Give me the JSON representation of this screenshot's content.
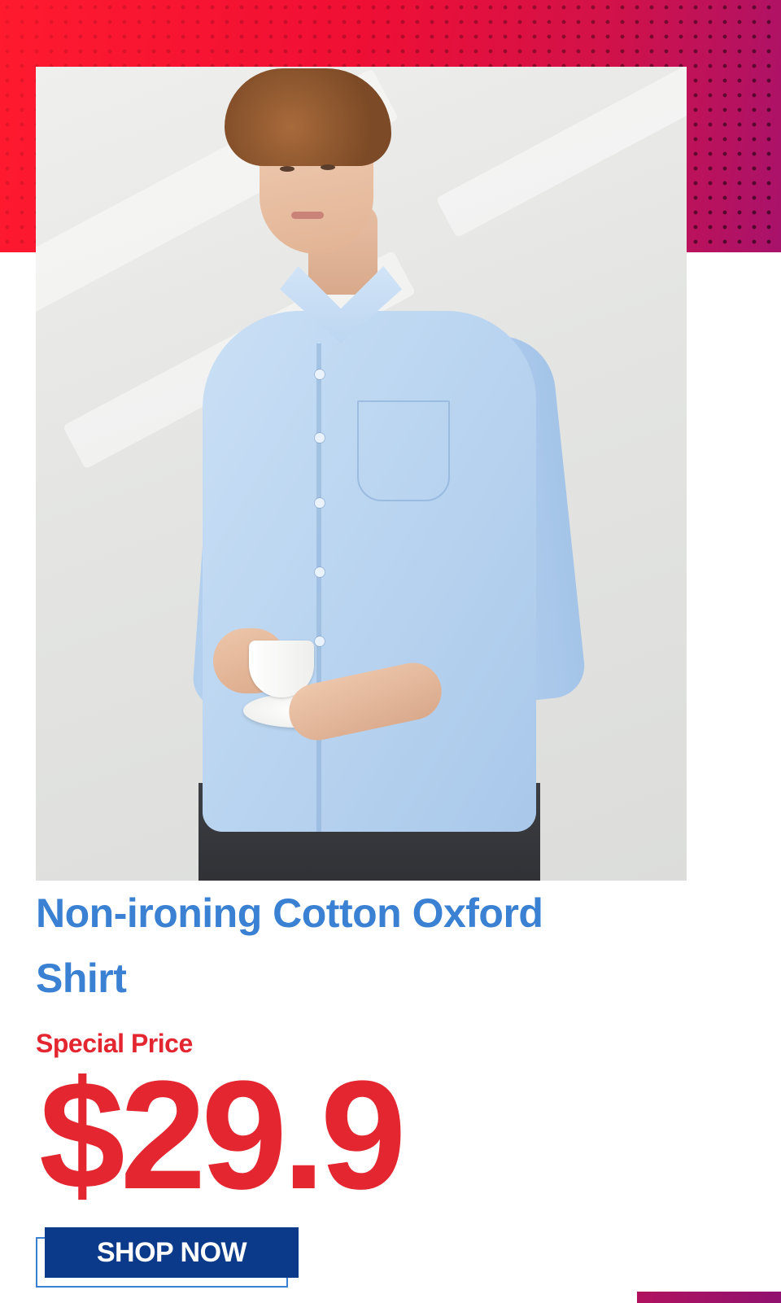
{
  "promo": {
    "product_name": "Non-ironing Cotton Oxford Shirt",
    "price_label": "Special Price",
    "price": "$29.9",
    "cta_label": "SHOP NOW"
  },
  "image": {
    "subject": "model-wearing-light-blue-oxford-shirt-holding-cup-and-saucer"
  },
  "colors": {
    "accent_red": "#e3262f",
    "title_blue": "#3a80d3",
    "button_navy": "#0c3a8a",
    "band_magenta": "#a8126b"
  }
}
